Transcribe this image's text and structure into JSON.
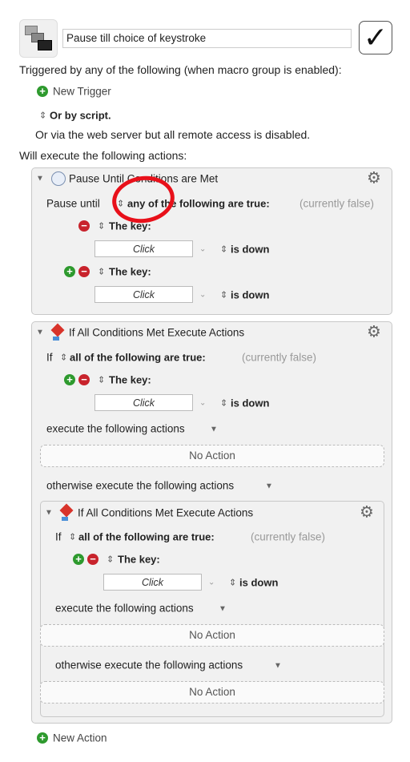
{
  "macro": {
    "title": "Pause till choice of keystroke",
    "enabled": true,
    "triggered_label": "Triggered by any of the following (when macro group is enabled):",
    "new_trigger": "New Trigger",
    "or_by_script": "Or by script.",
    "web_server": "Or via the web server but all remote access is disabled.",
    "will_execute": "Will execute the following actions:",
    "new_action": "New Action"
  },
  "pause_block": {
    "title": "Pause Until Conditions are Met",
    "prefix": "Pause until",
    "mode": "any of the following are true:",
    "status": "(currently false)",
    "conditions": [
      {
        "label": "The key:",
        "value": "Click",
        "state": "is down"
      },
      {
        "label": "The key:",
        "value": "Click",
        "state": "is down"
      }
    ]
  },
  "if_block": {
    "title": "If All Conditions Met Execute Actions",
    "prefix": "If",
    "mode": "all of the following are true:",
    "status": "(currently false)",
    "condition": {
      "label": "The key:",
      "value": "Click",
      "state": "is down"
    },
    "execute_label": "execute the following actions",
    "no_action": "No Action",
    "otherwise_label": "otherwise execute the following actions"
  },
  "nested_if_block": {
    "title": "If All Conditions Met Execute Actions",
    "prefix": "If",
    "mode": "all of the following are true:",
    "status": "(currently false)",
    "condition": {
      "label": "The key:",
      "value": "Click",
      "state": "is down"
    },
    "execute_label": "execute the following actions",
    "no_action_1": "No Action",
    "otherwise_label": "otherwise execute the following actions",
    "no_action_2": "No Action"
  },
  "colors": {
    "annotation": "#e8101a",
    "plus": "#2e9a2e",
    "minus": "#c8232c"
  }
}
